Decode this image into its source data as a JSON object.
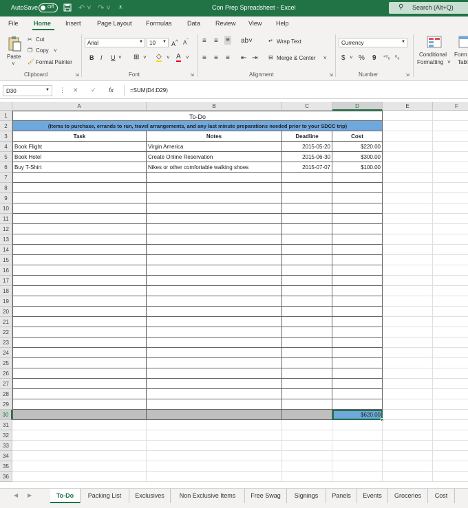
{
  "titlebar": {
    "autosave_label": "AutoSave",
    "autosave_state": "Off",
    "document_title": "Con Prep Spreadsheet  -  Excel",
    "search_placeholder": "Search (Alt+Q)",
    "icons": [
      "save-icon",
      "undo-icon",
      "redo-icon",
      "customize-icon",
      "search-icon"
    ]
  },
  "menu": {
    "tabs": [
      "File",
      "Home",
      "Insert",
      "Page Layout",
      "Formulas",
      "Data",
      "Review",
      "View",
      "Help"
    ],
    "active": "Home"
  },
  "ribbon": {
    "clipboard": {
      "paste": "Paste",
      "cut": "Cut",
      "copy": "Copy",
      "format_painter": "Format Painter",
      "label": "Clipboard"
    },
    "font": {
      "name": "Arial",
      "size": "10",
      "bold": "B",
      "italic": "I",
      "underline": "U",
      "label": "Font"
    },
    "alignment": {
      "wrap_text": "Wrap Text",
      "merge_center": "Merge & Center",
      "label": "Alignment"
    },
    "number": {
      "format": "Currency",
      "dollar": "$",
      "percent": "%",
      "comma": "9",
      "label": "Number"
    },
    "styles": {
      "conditional_formatting_1": "Conditional",
      "conditional_formatting_2": "Formatting",
      "format_table_1": "Form",
      "format_table_2": "Tabl"
    }
  },
  "formula_bar": {
    "name_box": "D30",
    "fx": "fx",
    "formula": "=SUM(D4:D29)"
  },
  "grid": {
    "columns": [
      "A",
      "B",
      "C",
      "D",
      "E",
      "F"
    ],
    "selected_column": "D",
    "selected_row": "30",
    "title": "To-Do",
    "subtitle": "(Items to purchase, errands to run, travel arrangements, and any last minute preparations needed prior to your SDCC trip)",
    "headers": [
      "Task",
      "Notes",
      "Deadline",
      "Cost"
    ],
    "rows": [
      {
        "task": "Book Flight",
        "notes": "Virgin America",
        "deadline": "2015-05-20",
        "cost": "$220.00"
      },
      {
        "task": "Book Hotel",
        "notes": "Create Online Reservation",
        "deadline": "2015-06-30",
        "cost": "$300.00"
      },
      {
        "task": "Buy T-Shirt",
        "notes": "Nikes or other comfortable walking shoes",
        "deadline": "2015-07-07",
        "cost": "$100.00"
      }
    ],
    "total": "$620.00"
  },
  "sheet_tabs": {
    "tabs": [
      "To-Do",
      "Packing List",
      "Exclusives",
      "Non Exclusive Items",
      "Free Swag",
      "Signings",
      "Panels",
      "Events",
      "Groceries",
      "Cost"
    ],
    "active": "To-Do"
  },
  "colors": {
    "excel_green": "#217346",
    "header_blue": "#6fa8dc",
    "total_gray": "#bfbfbf"
  }
}
